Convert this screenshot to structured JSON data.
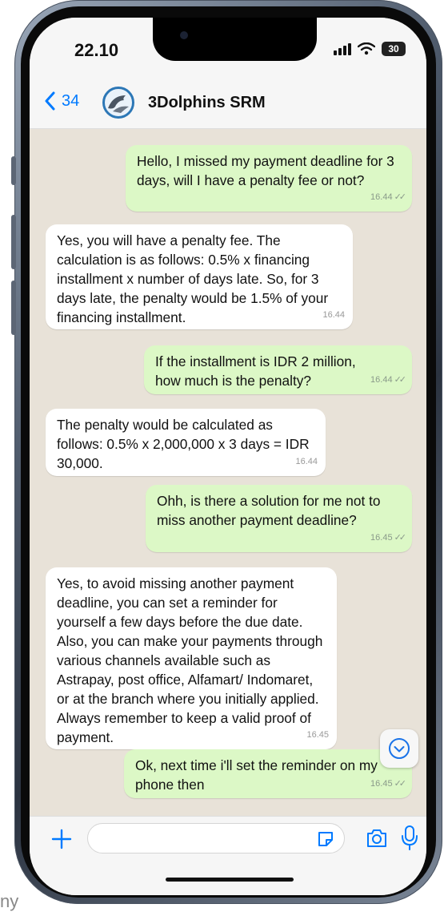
{
  "status_bar": {
    "time": "22.10",
    "battery": "30"
  },
  "header": {
    "back_count": "34",
    "contact_name": "3Dolphins SRM"
  },
  "messages": [
    {
      "direction": "out",
      "text": "Hello, I missed my payment deadline for 3 days, will I have a penalty fee or not?",
      "time": "16.44"
    },
    {
      "direction": "in",
      "text": "Yes, you will have a penalty fee. The calculation is as follows: 0.5% x financing installment x number of days late. So, for 3 days late, the penalty would be 1.5% of your financing installment.",
      "time": "16.44"
    },
    {
      "direction": "out",
      "text": "If the installment is IDR 2 million, how much is the penalty?",
      "time": "16.44"
    },
    {
      "direction": "in",
      "text": "The penalty would be calculated as follows: 0.5% x 2,000,000 x 3 days = IDR 30,000.",
      "time": "16.44"
    },
    {
      "direction": "out",
      "text": "Ohh, is there a solution for me not to miss another payment deadline?",
      "time": "16.45"
    },
    {
      "direction": "in",
      "text": "Yes, to avoid missing another payment deadline, you can set a reminder for yourself a few days before the due date. Also, you can make your payments through various channels available such as Astrapay, post office, Alfamart/ Indomaret, or at the branch where you initially applied. Always remember to keep a valid proof of payment.",
      "time": "16.45"
    },
    {
      "direction": "out",
      "text": "Ok, next time i'll set the reminder on my phone then",
      "time": "16.45"
    }
  ],
  "read_ticks": "✓✓",
  "input": {
    "value": "",
    "placeholder": ""
  },
  "outside_text": "ny",
  "colors": {
    "outgoing": "#dcf8c6",
    "incoming": "#ffffff",
    "accent": "#007aff"
  },
  "icons": {
    "back": "chevron-left-icon",
    "plus": "plus-icon",
    "sticker": "sticker-icon",
    "camera": "camera-icon",
    "mic": "microphone-icon",
    "scroll": "chevron-down-circle-icon"
  }
}
